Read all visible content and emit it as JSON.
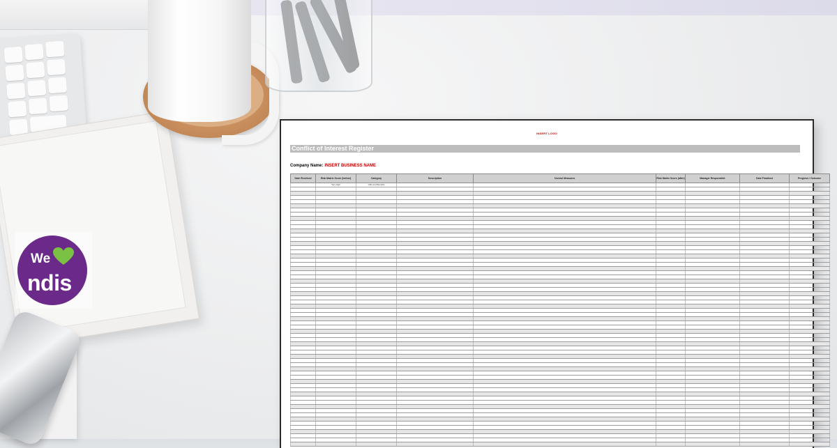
{
  "logo": {
    "word_we": "We",
    "word_brand": "ndis",
    "icon": "heart-icon",
    "circle_color": "#6b2a8a",
    "heart_color": "#7bc144"
  },
  "document": {
    "insert_logo": "INSERT LOGO",
    "title": "Conflict of Interest Register",
    "company_label": "Company Name:",
    "company_value": "INSERT BUSINESS NAME",
    "accent_color": "#c00000",
    "columns": [
      "Date Received",
      "Risk Matrix Score (before)",
      "Category",
      "Description",
      "Control Measures",
      "Risk Matrix Score (after)",
      "Manager Responsible",
      "Date Finalised",
      "Progress / Outcome"
    ],
    "first_row": [
      "",
      "Very High",
      "Gifts and Benefits",
      "",
      "",
      "",
      "",
      "",
      ""
    ]
  }
}
